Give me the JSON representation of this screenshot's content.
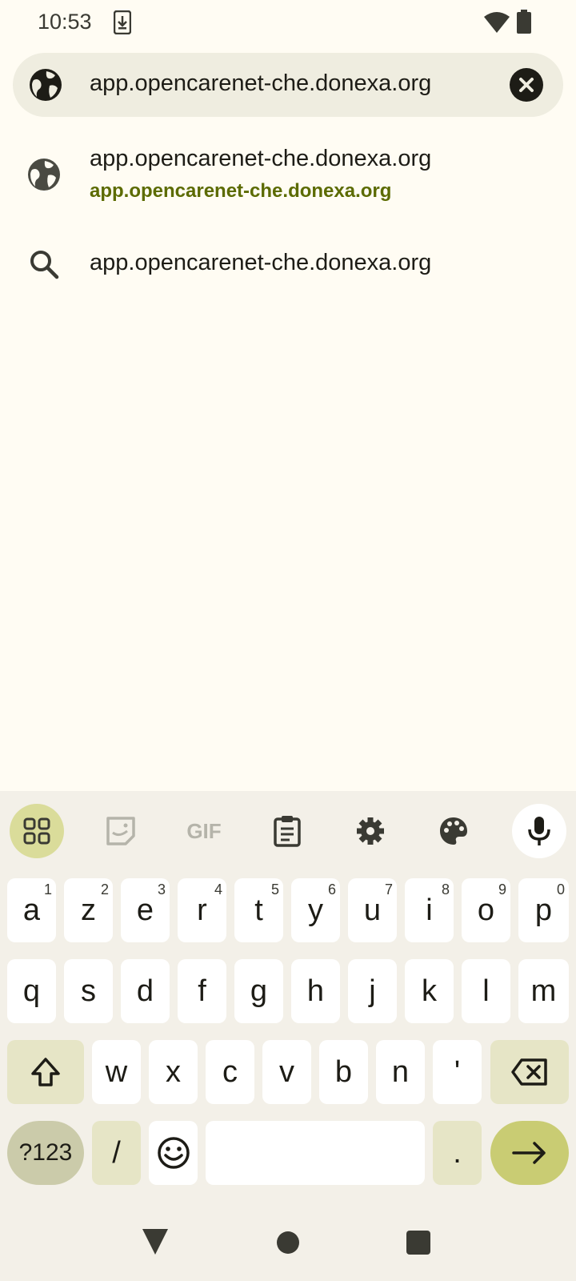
{
  "status_bar": {
    "time": "10:53",
    "icons": [
      "download-icon",
      "wifi-icon",
      "battery-icon"
    ]
  },
  "url_bar": {
    "value": "app.opencarenet-che.donexa.org",
    "site_icon": "globe-icon",
    "clear_icon": "close-icon"
  },
  "suggestions": [
    {
      "icon": "globe-icon",
      "title": "app.opencarenet-che.donexa.org",
      "url": "app.opencarenet-che.donexa.org"
    },
    {
      "icon": "search-icon",
      "title": "app.opencarenet-che.donexa.org"
    }
  ],
  "keyboard": {
    "toolbar": [
      "apps-grid-icon",
      "sticker-icon",
      "gif-icon",
      "clipboard-icon",
      "settings-icon",
      "palette-icon",
      "mic-icon"
    ],
    "gif_label": "GIF",
    "row1": [
      {
        "k": "a",
        "h": "1"
      },
      {
        "k": "z",
        "h": "2"
      },
      {
        "k": "e",
        "h": "3"
      },
      {
        "k": "r",
        "h": "4"
      },
      {
        "k": "t",
        "h": "5"
      },
      {
        "k": "y",
        "h": "6"
      },
      {
        "k": "u",
        "h": "7"
      },
      {
        "k": "i",
        "h": "8"
      },
      {
        "k": "o",
        "h": "9"
      },
      {
        "k": "p",
        "h": "0"
      }
    ],
    "row2": [
      "q",
      "s",
      "d",
      "f",
      "g",
      "h",
      "j",
      "k",
      "l",
      "m"
    ],
    "row3": [
      "w",
      "x",
      "c",
      "v",
      "b",
      "n",
      "'"
    ],
    "symbols_label": "?123",
    "slash_label": "/",
    "period_label": ".",
    "colors": {
      "accent": "#c9cc73",
      "modifier": "#e6e5c6",
      "suggestion_url": "#5c6b00"
    }
  },
  "nav_bar": [
    "back-icon",
    "home-icon",
    "recents-icon"
  ]
}
